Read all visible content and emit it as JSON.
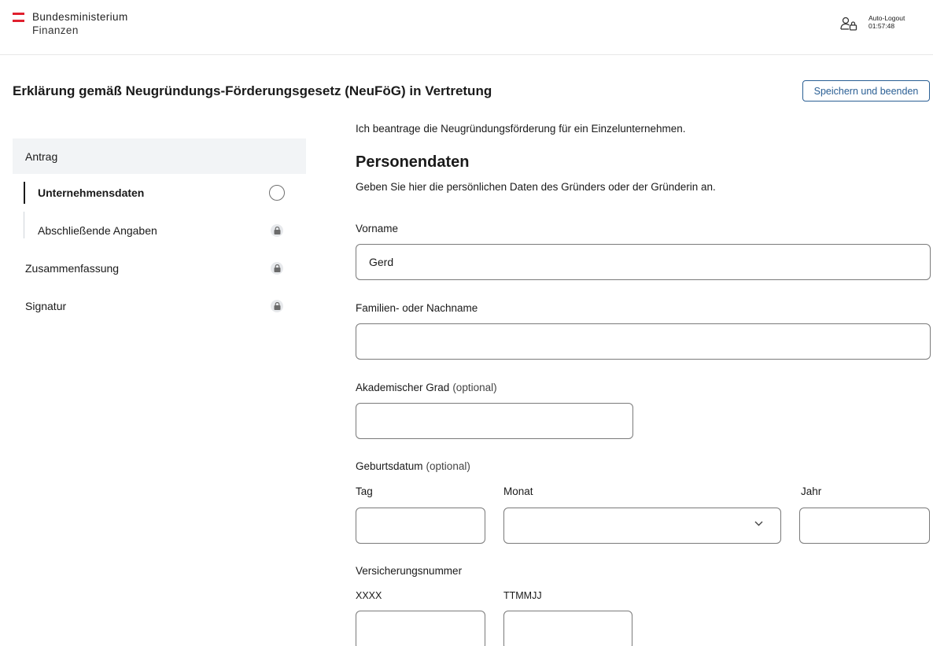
{
  "header": {
    "brand_line1": "Bundesministerium",
    "brand_line2": "Finanzen",
    "auto_logout_label": "Auto-Logout",
    "auto_logout_time": "01:57:48",
    "user_icon": "user-lock-icon"
  },
  "page": {
    "title": "Erklärung gemäß Neugründungs-Förderungsgesetz (NeuFöG) in Vertretung",
    "save_button": "Speichern und beenden"
  },
  "sidebar": {
    "section": "Antrag",
    "items": [
      {
        "label": "Unternehmensdaten",
        "status": "in-progress"
      },
      {
        "label": "Abschließende Angaben",
        "status": "locked"
      },
      {
        "label": "Zusammenfassung",
        "status": "locked"
      },
      {
        "label": "Signatur",
        "status": "locked"
      }
    ]
  },
  "form": {
    "intro": "Ich beantrage die Neugründungsförderung für ein Einzelunternehmen.",
    "section_title": "Personendaten",
    "section_desc": "Geben Sie hier die persönlichen Daten des Gründers oder der Gründerin an.",
    "optional_suffix": "(optional)",
    "vorname": {
      "label": "Vorname",
      "value": "Gerd"
    },
    "nachname": {
      "label": "Familien- oder Nachname",
      "value": ""
    },
    "grad": {
      "label": "Akademischer Grad",
      "value": ""
    },
    "geburtsdatum": {
      "label": "Geburtsdatum",
      "tag_label": "Tag",
      "monat_label": "Monat",
      "jahr_label": "Jahr",
      "tag": "",
      "monat": "",
      "jahr": ""
    },
    "versicherung": {
      "label": "Versicherungsnummer",
      "part1_label": "XXXX",
      "part2_label": "TTMMJJ",
      "part1": "",
      "part2": ""
    }
  },
  "colors": {
    "accent": "#2a5f94",
    "brand_red": "#e0202e",
    "sidebar_bg": "#f2f4f6",
    "border": "#7a7a7a"
  }
}
